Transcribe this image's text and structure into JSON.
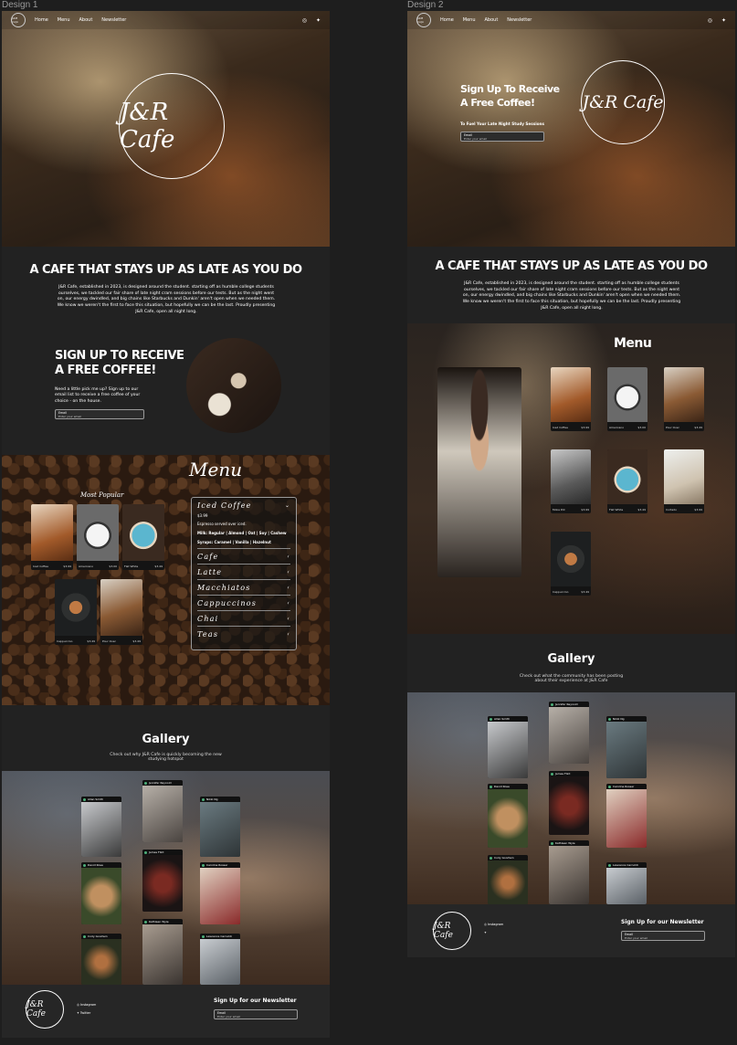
{
  "frames": {
    "design1_label": "Design 1",
    "design2_label": "Design 2"
  },
  "nav": {
    "logo": "J&R Cafe",
    "links": [
      "Home",
      "Menu",
      "About",
      "Newsletter"
    ],
    "icons": [
      "instagram-icon",
      "twitter-icon"
    ]
  },
  "brand": {
    "logo_text": "J&R Cafe"
  },
  "about": {
    "title": "A Cafe That Stays Up As Late As You Do",
    "body": "J&R Cafe, established in 2023, is designed around the student. starting off as humble college students ourselves, we tackled our fair share of late night cram sessions before our tests. But as the night went on, our energy dwindled, and big chains like Starbucks and Dunkin' aren't open when we needed them. We know we weren't the first to face this situation, but hopefully we can be the last. Proudly presenting J&R Cafe, open all night long."
  },
  "signup": {
    "title_line1": "Sign Up To Receive",
    "title_line2": "A Free Coffee!",
    "body": "Need a little pick me up? Sign up to our email list to receive a free coffee of your choice - on the house.",
    "d2_sub": "To Fuel Your Late Night Study Sessions",
    "email_label": "Email",
    "email_placeholder": "Enter your email"
  },
  "menu": {
    "title": "Menu",
    "most_popular": "Most Popular",
    "popular_items": [
      {
        "name": "Iced Coffee",
        "price": "$3.99"
      },
      {
        "name": "Americano",
        "price": "$3.00"
      },
      {
        "name": "Flat White",
        "price": "$3.49"
      },
      {
        "name": "Cappuccino",
        "price": "$3.49"
      },
      {
        "name": "Pour Over",
        "price": "$3.49"
      }
    ],
    "d2_items": [
      {
        "name": "Iced Coffee",
        "price": "$3.99"
      },
      {
        "name": "Americano",
        "price": "$3.00"
      },
      {
        "name": "Pour Over",
        "price": "$3.49"
      },
      {
        "name": "Moka Pot",
        "price": "$3.99"
      },
      {
        "name": "Flat White",
        "price": "$3.49"
      },
      {
        "name": "Cortado",
        "price": "$3.99"
      },
      {
        "name": "Cappuccino",
        "price": "$3.49"
      }
    ],
    "accordion": {
      "open": {
        "title": "Iced Coffee",
        "price": "$3.99",
        "desc": "Espresso served over iced.",
        "milk": "Milk: Regular | Almond | Oat | Soy | Cashew",
        "syrups": "Syrups: Caramel | Vanilla | Hazelnut"
      },
      "closed": [
        "Cafe",
        "Latte",
        "Macchiatos",
        "Cappuccinos",
        "Chai",
        "Teas"
      ]
    }
  },
  "gallery": {
    "title": "Gallery",
    "sub_d1_line1": "Check out why J&R Cafe is quickly becoming the new",
    "sub_d1_line2": "studying hotspot",
    "sub_d2_line1": "Check out what the community has been posting",
    "sub_d2_line2": "about their experience at J&R Cafe",
    "users": [
      "Allan Smith",
      "Jennifer Reynold",
      "Nikki Ng",
      "David Rose",
      "James Flint",
      "Caroline Rosser",
      "Cody Goodwin",
      "Kathleen Wyle",
      "Lawrence Carnoldi"
    ]
  },
  "footer": {
    "instagram": "Instagram",
    "twitter": "Twitter",
    "newsletter_title": "Sign Up for our Newsletter",
    "email_label": "Email",
    "email_placeholder": "Enter your email"
  },
  "colors": {
    "bg": "#1e1e1e",
    "panel": "#222222",
    "accent_green": "#4caf7a"
  }
}
